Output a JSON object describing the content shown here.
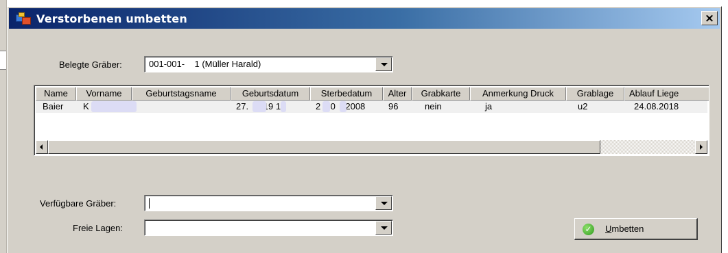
{
  "window": {
    "title": "Verstorbenen umbetten",
    "close_symbol": "×"
  },
  "belegte": {
    "label": "Belegte Gräber:",
    "value": "001-001-    1 (Müller Harald)"
  },
  "grid": {
    "columns": [
      "Name",
      "Vorname",
      "Geburtstagsname",
      "Geburtsdatum",
      "Sterbedatum",
      "Alter",
      "Grabkarte",
      "Anmerkung Druck",
      "Grablage",
      "Ablauf Liege"
    ],
    "rows": [
      {
        "name": "Baier",
        "vorname": "K",
        "geburtstagsname": "",
        "geburtsdatum": "27.      19 1",
        "sterbedatum": "2   .0   .2008",
        "alter": "96",
        "grabkarte": "nein",
        "anmerkung": "ja",
        "grablage": "u2",
        "ablauf": "24.08.2018"
      }
    ]
  },
  "verfuegbar": {
    "label": "Verfügbare Gräber:",
    "value": ""
  },
  "freie": {
    "label": "Freie Lagen:",
    "value": ""
  },
  "umbetten_button": {
    "mnemonic": "U",
    "rest": "mbetten",
    "icon": "check-icon"
  },
  "colors": {
    "title_start": "#0a246a",
    "title_end": "#a6caf0",
    "face": "#d4d0c8",
    "ok_green": "#2f9a1e"
  }
}
